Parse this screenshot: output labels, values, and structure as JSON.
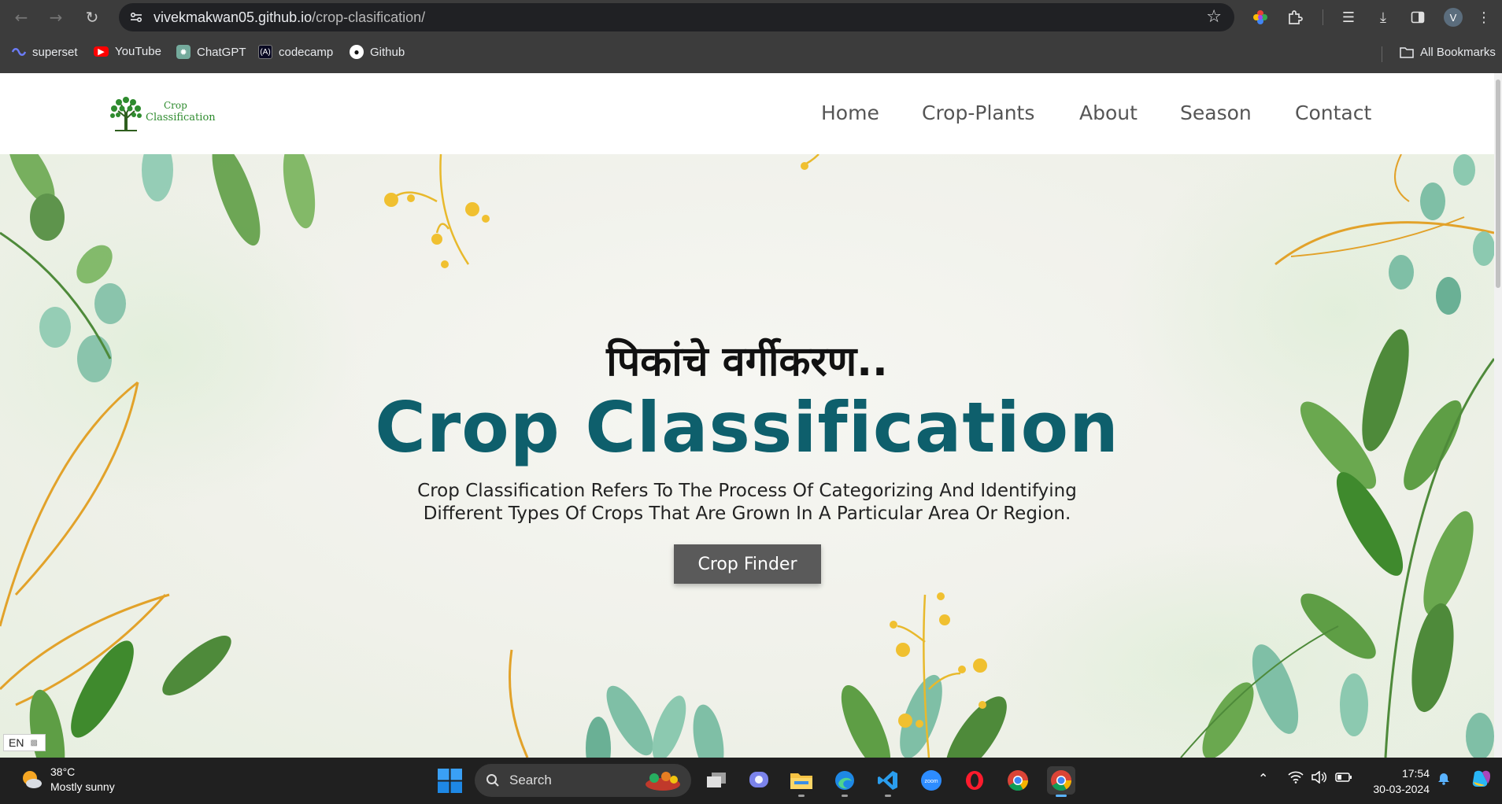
{
  "browser": {
    "url_host": "vivekmakwan05.github.io",
    "url_path": "/crop-clasification/",
    "bookmarks": [
      {
        "label": "superset"
      },
      {
        "label": "YouTube"
      },
      {
        "label": "ChatGPT"
      },
      {
        "label": "codecamp"
      },
      {
        "label": "Github"
      }
    ],
    "all_bookmarks_label": "All Bookmarks",
    "profile_initial": "V"
  },
  "site": {
    "logo_line1": "Crop",
    "logo_line2": "Classification",
    "nav": [
      "Home",
      "Crop-Plants",
      "About",
      "Season",
      "Contact"
    ],
    "hero_marathi": "पिकांचे वर्गीकरण..",
    "hero_title": "Crop Classification",
    "hero_desc_line1": "Crop Classification Refers To The Process Of Categorizing And Identifying",
    "hero_desc_line2": "Different Types Of Crops That Are Grown In A Particular Area Or Region.",
    "cta_label": "Crop Finder",
    "colors": {
      "title": "#0e5f6c",
      "button": "#5a5a5a",
      "logo_green": "#2e8b2e"
    }
  },
  "ime": {
    "lang": "EN"
  },
  "taskbar": {
    "weather_temp": "38°C",
    "weather_desc": "Mostly sunny",
    "search_label": "Search",
    "time": "17:54",
    "date": "30-03-2024",
    "apps": [
      "task-view",
      "teams",
      "file-explorer",
      "edge",
      "vscode",
      "zoom",
      "opera",
      "chrome",
      "chrome-active"
    ]
  }
}
